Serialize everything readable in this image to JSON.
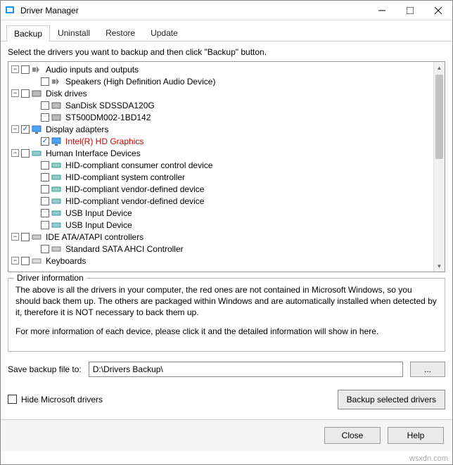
{
  "window": {
    "title": "Driver Manager"
  },
  "tabs": {
    "backup": "Backup",
    "uninstall": "Uninstall",
    "restore": "Restore",
    "update": "Update"
  },
  "instruction": "Select the drivers you want to backup and then click \"Backup\" button.",
  "tree": {
    "n0": "Audio inputs and outputs",
    "n0_0": "Speakers (High Definition Audio Device)",
    "n1": "Disk drives",
    "n1_0": "SanDisk SDSSDA120G",
    "n1_1": "ST500DM002-1BD142",
    "n2": "Display adapters",
    "n2_0": "Intel(R) HD Graphics",
    "n3": "Human Interface Devices",
    "n3_0": "HID-compliant consumer control device",
    "n3_1": "HID-compliant system controller",
    "n3_2": "HID-compliant vendor-defined device",
    "n3_3": "HID-compliant vendor-defined device",
    "n3_4": "USB Input Device",
    "n3_5": "USB Input Device",
    "n4": "IDE ATA/ATAPI controllers",
    "n4_0": "Standard SATA AHCI Controller",
    "n5": "Keyboards"
  },
  "info": {
    "title": "Driver information",
    "p1": "The above is all the drivers in your computer, the red ones are not contained in Microsoft Windows, so you should back them up. The others are packaged within Windows and are automatically installed when detected by it, therefore it is NOT necessary to back them up.",
    "p2": "For more information of each device, please click it and the detailed information will show in here."
  },
  "save": {
    "label": "Save backup file to:",
    "path": "D:\\Drivers Backup\\",
    "browse": "..."
  },
  "hide": "Hide Microsoft drivers",
  "buttons": {
    "backup": "Backup selected drivers",
    "close": "Close",
    "help": "Help"
  },
  "watermark": "wsxdn.com"
}
